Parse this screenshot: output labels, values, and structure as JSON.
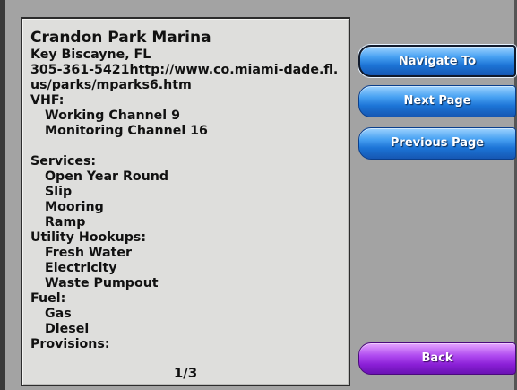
{
  "info": {
    "title": "Crandon Park Marina",
    "location": "Key Biscayne, FL",
    "contact": "305-361-5421http://www.co.miami-dade.fl.us/parks/mparks6.htm",
    "vhf_heading": "VHF:",
    "vhf_items": [
      "Working Channel 9",
      "Monitoring Channel 16"
    ],
    "services_heading": "Services:",
    "services_items": [
      "Open Year Round",
      "Slip",
      "Mooring",
      "Ramp"
    ],
    "utility_heading": "Utility Hookups:",
    "utility_items": [
      "Fresh Water",
      "Electricity",
      "Waste Pumpout"
    ],
    "fuel_heading": "Fuel:",
    "fuel_items": [
      "Gas",
      "Diesel"
    ],
    "provisions_heading": "Provisions:",
    "page_counter": "1/3"
  },
  "buttons": {
    "navigate_to": "Navigate To",
    "next_page": "Next Page",
    "previous_page": "Previous Page",
    "back": "Back"
  },
  "colors": {
    "button_blue": "#1c74d6",
    "button_purple": "#8a1fd6",
    "panel_background": "#dededc",
    "screen_background": "#a3a3a3"
  }
}
